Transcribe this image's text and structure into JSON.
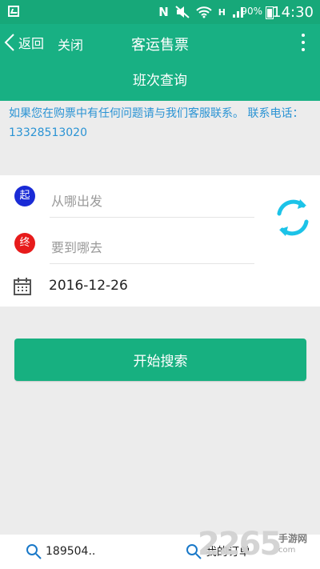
{
  "status_bar": {
    "carrier_mark": "N",
    "signal_type": "H",
    "battery": "90%",
    "time": "14:30"
  },
  "header": {
    "back_label": "返回",
    "close_label": "关闭",
    "title": "客运售票"
  },
  "subheader": {
    "title": "班次查询"
  },
  "notice": {
    "text": "如果您在购票中有任何问题请与我们客服联系。 联系电话：13328513020"
  },
  "route": {
    "start_badge": "起",
    "end_badge": "终",
    "from_placeholder": "从哪出发",
    "to_placeholder": "要到哪去",
    "date": "2016-12-26"
  },
  "actions": {
    "search_label": "开始搜索"
  },
  "bottom_bar": {
    "left_label": "189504..",
    "right_label": "我的订单"
  },
  "watermark": {
    "number": "2265",
    "text": "手游网",
    "url": "com"
  },
  "colors": {
    "brand_green": "#18b083",
    "swap_blue": "#1cc3e8",
    "start_dot": "#1a2bd6",
    "end_dot": "#e71b1b"
  },
  "icons": {
    "status_left": "image-icon",
    "swap": "swap-route-icon",
    "calendar": "calendar-icon",
    "search": "search-icon"
  }
}
